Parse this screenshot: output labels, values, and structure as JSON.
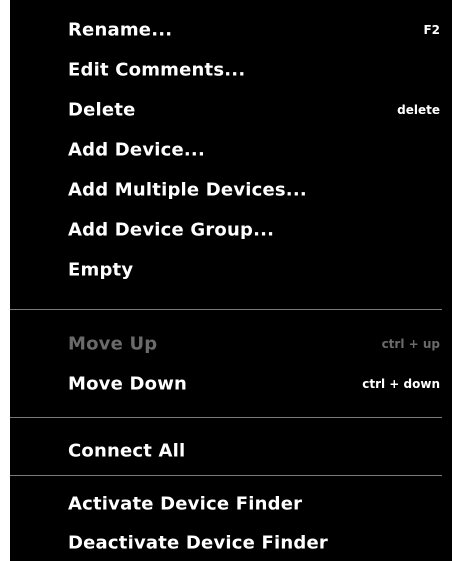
{
  "menu": {
    "items": [
      {
        "label": "Rename...",
        "shortcut": "F2",
        "enabled": true
      },
      {
        "label": "Edit Comments...",
        "shortcut": "",
        "enabled": true
      },
      {
        "label": "Delete",
        "shortcut": "delete",
        "enabled": true
      },
      {
        "label": "Add Device...",
        "shortcut": "",
        "enabled": true
      },
      {
        "label": "Add Multiple Devices...",
        "shortcut": "",
        "enabled": true
      },
      {
        "label": "Add Device Group...",
        "shortcut": "",
        "enabled": true
      },
      {
        "label": "Empty",
        "shortcut": "",
        "enabled": true
      },
      {
        "label": "Move Up",
        "shortcut": "ctrl + up",
        "enabled": false
      },
      {
        "label": "Move Down",
        "shortcut": "ctrl + down",
        "enabled": true
      },
      {
        "label": "Connect All",
        "shortcut": "",
        "enabled": true
      },
      {
        "label": "Activate Device Finder",
        "shortcut": "",
        "enabled": true
      },
      {
        "label": "Deactivate Device Finder",
        "shortcut": "",
        "enabled": true
      }
    ]
  },
  "colors": {
    "background": "#000000",
    "text": "#ffffff",
    "disabled_text": "#6a6a6a",
    "separator": "#7a7a7a"
  }
}
